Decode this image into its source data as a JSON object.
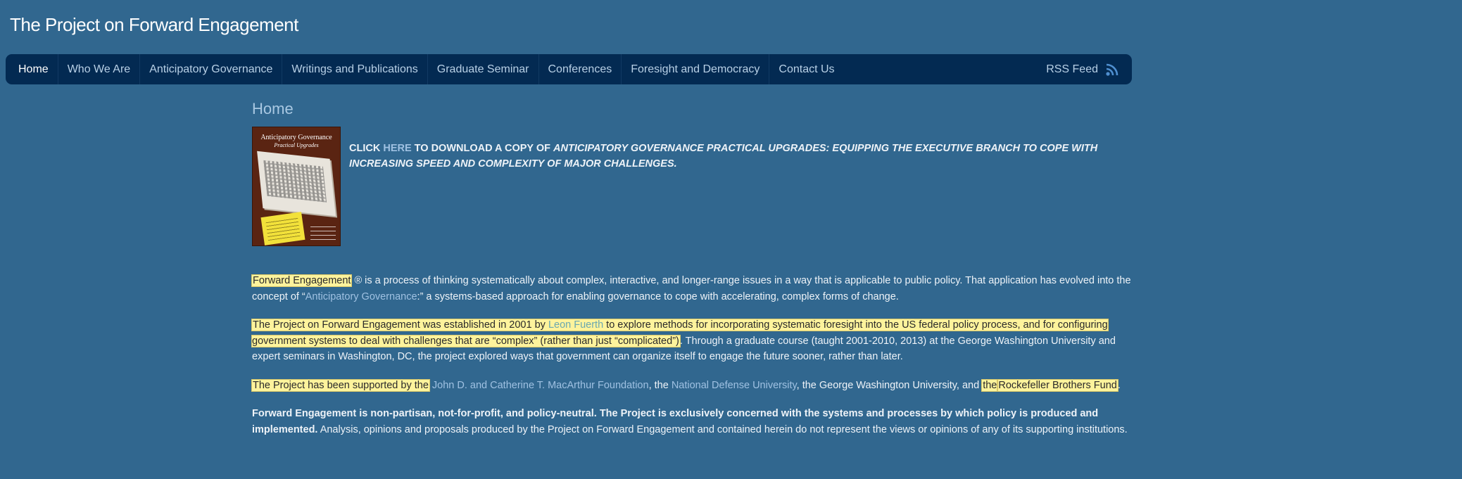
{
  "site": {
    "title": "The Project on Forward Engagement"
  },
  "nav": {
    "items": [
      {
        "label": "Home",
        "active": true
      },
      {
        "label": "Who We Are"
      },
      {
        "label": "Anticipatory Governance"
      },
      {
        "label": "Writings and Publications"
      },
      {
        "label": "Graduate Seminar"
      },
      {
        "label": "Conferences"
      },
      {
        "label": "Foresight and Democracy"
      },
      {
        "label": "Contact Us"
      }
    ],
    "rss_label": "RSS Feed",
    "rss_icon": "rss-icon"
  },
  "page": {
    "title": "Home"
  },
  "book_cover": {
    "title": "Anticipatory Governance",
    "subtitle": "Practical Upgrades"
  },
  "promo": {
    "prefix": "CLICK ",
    "link": "HERE",
    "middle": " TO DOWNLOAD A COPY OF ",
    "book_title": "ANTICIPATORY GOVERNANCE PRACTICAL UPGRADES: EQUIPPING THE EXECUTIVE BRANCH TO COPE WITH INCREASING SPEED AND COMPLEXITY OF MAJOR CHALLENGES."
  },
  "para1": {
    "highlight": "Forward Engagement",
    "text1": " ® is a process of thinking systematically about complex, interactive, and longer-range issues in a way that is applicable to public policy. That application has evolved into the concept of “",
    "link": "Anticipatory Governance",
    "text2": ":” a systems-based approach for enabling governance to cope with accelerating, complex forms of change."
  },
  "para2": {
    "hl1": "The Project on Forward Engagement was established in 2001 by ",
    "link": "Leon Fuerth",
    "hl2": " to explore methods for incorporating systematic foresight into the US federal policy process, and for configuring government systems to deal with challenges that are “complex” (rather than just “complicated”)",
    "text": ". Through a graduate course (taught 2001-2010, 2013) at the George Washington University and expert seminars in Washington, DC, the project explored ways that government can organize itself to engage the future sooner, rather than later."
  },
  "para3": {
    "hl1": "The Project has been supported by the",
    "link1": "John D. and Catherine T. MacArthur Foundation",
    "text1": ", the ",
    "link2": "National Defense University",
    "text2": ", the George Washington University, and ",
    "hl2": "the",
    "hl3": "Rockefeller Brothers Fund",
    "text3": "."
  },
  "para4": {
    "bold": "Forward Engagement is non-partisan, not-for-profit, and policy-neutral. The Project is exclusively concerned with the systems and processes by which policy is produced and implemented.",
    "text": " Analysis, opinions and proposals produced by the Project on Forward Engagement and contained herein do not represent the views or opinions of any of its supporting institutions."
  },
  "colors": {
    "background": "#31678f",
    "navbar": "#032a52",
    "link": "#9fc1e2",
    "highlight": "#fdf39c"
  }
}
